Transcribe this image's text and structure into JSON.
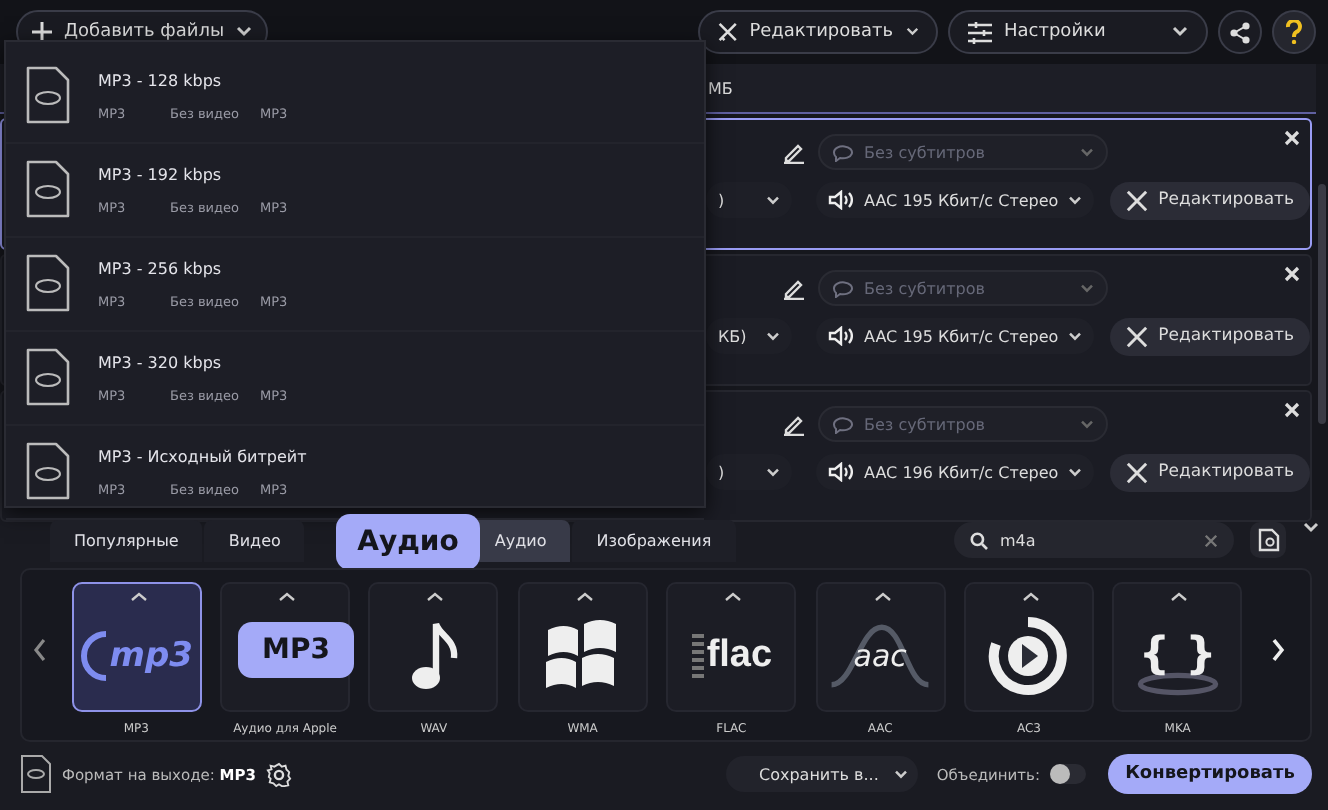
{
  "toolbar": {
    "add_files": "Добавить файлы",
    "edit": "Редактировать",
    "settings": "Настройки"
  },
  "file_list": {
    "header_fragment": "МБ",
    "files": [
      {
        "selected": true,
        "format_fragment": ")",
        "subtitles_placeholder": "Без субтитров",
        "audio": "AAC 195 Кбит/с Стерео",
        "edit_button": "Редактировать"
      },
      {
        "selected": false,
        "format_fragment": "КБ)",
        "subtitles_placeholder": "Без субтитров",
        "audio": "AAC 195 Кбит/с Стерео",
        "edit_button": "Редактировать"
      },
      {
        "selected": false,
        "format_fragment": ")",
        "subtitles_placeholder": "Без субтитров",
        "audio": "AAC 196 Кбит/с Стерео",
        "edit_button": "Редактировать"
      }
    ]
  },
  "preset_menu": {
    "items": [
      {
        "title": "MP3 - 128 kbps",
        "details": [
          "MP3",
          "Без видео",
          "MP3"
        ]
      },
      {
        "title": "MP3 - 192 kbps",
        "details": [
          "MP3",
          "Без видео",
          "MP3"
        ]
      },
      {
        "title": "MP3 - 256 kbps",
        "details": [
          "MP3",
          "Без видео",
          "MP3"
        ]
      },
      {
        "title": "MP3 - 320 kbps",
        "details": [
          "MP3",
          "Без видео",
          "MP3"
        ]
      },
      {
        "title": "MP3 - Исходный битрейт",
        "details": [
          "MP3",
          "Без видео",
          "MP3"
        ]
      }
    ]
  },
  "format_tabs": [
    {
      "label": "Популярные",
      "selected": false
    },
    {
      "label": "Видео",
      "selected": false
    },
    {
      "label": "Аудио",
      "selected": true
    },
    {
      "label": "Изображения",
      "selected": false
    }
  ],
  "tab_tooltip": "Аудио",
  "search": {
    "value": "m4a"
  },
  "formats": [
    {
      "label": "MP3",
      "kind": "mp3",
      "logo_text": "mp3",
      "selected": true
    },
    {
      "label": "Аудио для Apple",
      "kind": "hidden",
      "selected": false
    },
    {
      "label": "WAV",
      "kind": "note",
      "selected": false
    },
    {
      "label": "WMA",
      "kind": "windows",
      "selected": false
    },
    {
      "label": "FLAC",
      "kind": "flac",
      "logo_text": "flac",
      "selected": false
    },
    {
      "label": "AAC",
      "kind": "aac",
      "logo_text": "aac",
      "selected": false
    },
    {
      "label": "AC3",
      "kind": "play",
      "selected": false
    },
    {
      "label": "MKA",
      "kind": "braces",
      "logo_text": "{ }",
      "selected": false
    }
  ],
  "format_tooltip": "MP3",
  "footer": {
    "output_label": "Формат на выходе:",
    "output_format": "MP3",
    "save_to": "Сохранить в...",
    "merge_label": "Объединить:",
    "merge_on": false,
    "convert": "Конвертировать"
  }
}
